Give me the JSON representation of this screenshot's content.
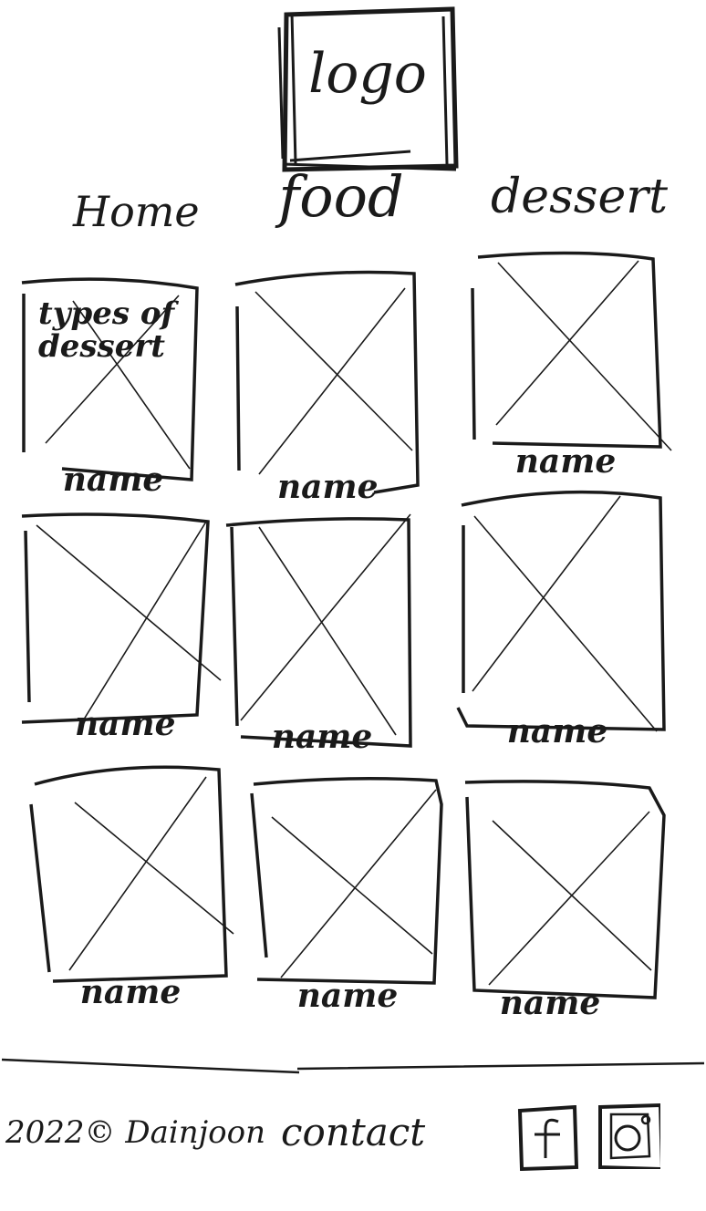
{
  "header": {
    "logo_text": "logo"
  },
  "nav": {
    "items": [
      {
        "label": "Home"
      },
      {
        "label": "food"
      },
      {
        "label": "dessert"
      }
    ]
  },
  "grid": {
    "caption": "types of dessert",
    "tiles": [
      {
        "name": "name"
      },
      {
        "name": "name"
      },
      {
        "name": "name"
      },
      {
        "name": "name"
      },
      {
        "name": "name"
      },
      {
        "name": "name"
      },
      {
        "name": "name"
      },
      {
        "name": "name"
      },
      {
        "name": "name"
      }
    ]
  },
  "footer": {
    "copyright": "2022© Dainjoon",
    "contact": "contact",
    "social": [
      {
        "icon": "facebook-icon",
        "glyph": "f"
      },
      {
        "icon": "instagram-icon",
        "glyph": "instagram"
      }
    ]
  },
  "colors": {
    "ink": "#1a1a1a",
    "background": "#ffffff"
  }
}
